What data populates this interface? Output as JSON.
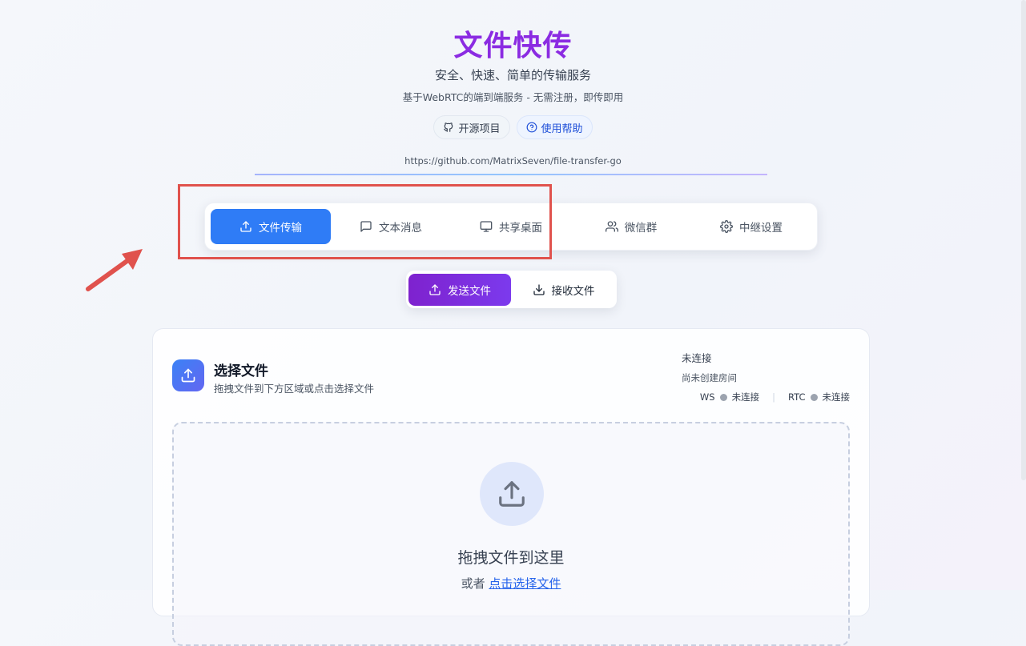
{
  "header": {
    "title": "文件快传",
    "subtitle": "安全、快速、简单的传输服务",
    "description": "基于WebRTC的端到端服务 - 无需注册，即传即用",
    "buttons": {
      "open_source": "开源项目",
      "help": "使用帮助"
    },
    "repo_url": "https://github.com/MatrixSeven/file-transfer-go"
  },
  "main_tabs": [
    {
      "label": "文件传输",
      "icon": "upload-icon",
      "active": true
    },
    {
      "label": "文本消息",
      "icon": "message-icon",
      "active": false
    },
    {
      "label": "共享桌面",
      "icon": "monitor-icon",
      "active": false
    },
    {
      "label": "微信群",
      "icon": "users-icon",
      "active": false
    },
    {
      "label": "中继设置",
      "icon": "gear-icon",
      "active": false
    }
  ],
  "mode_tabs": [
    {
      "label": "发送文件",
      "icon": "upload-icon",
      "active": true
    },
    {
      "label": "接收文件",
      "icon": "download-icon",
      "active": false
    }
  ],
  "card": {
    "title": "选择文件",
    "subtitle": "拖拽文件到下方区域或点击选择文件",
    "status": {
      "main": "未连接",
      "room": "尚未创建房间",
      "ws_label": "WS",
      "ws_state": "未连接",
      "rtc_label": "RTC",
      "rtc_state": "未连接"
    },
    "dropzone": {
      "title": "拖拽文件到这里",
      "or": "或者",
      "select_link": "点击选择文件"
    }
  },
  "colors": {
    "title": "#8b2be2",
    "active_tab": "#2f7cf6",
    "active_mode": "#7c3aed",
    "highlight_box": "#e0524d"
  }
}
